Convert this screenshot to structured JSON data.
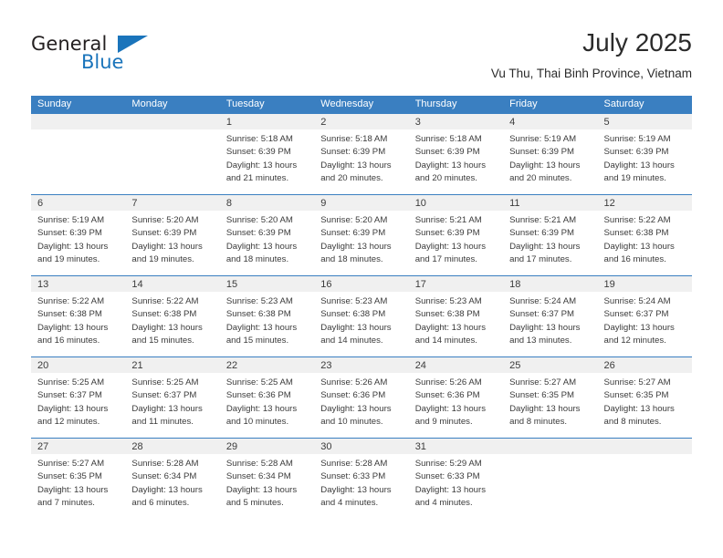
{
  "brand": {
    "name_part1": "General",
    "name_part2": "Blue",
    "triangle_color": "#1a74bb"
  },
  "header": {
    "title": "July 2025",
    "subtitle": "Vu Thu, Thai Binh Province, Vietnam"
  },
  "theme": {
    "header_blue": "#3a7fc1",
    "daynum_gray": "#f0f0f0",
    "text": "#3b3b3b"
  },
  "calendar": {
    "weekdays": [
      "Sunday",
      "Monday",
      "Tuesday",
      "Wednesday",
      "Thursday",
      "Friday",
      "Saturday"
    ],
    "weeks": [
      [
        {
          "day": "",
          "sunrise": "",
          "sunset": "",
          "daylight": ""
        },
        {
          "day": "",
          "sunrise": "",
          "sunset": "",
          "daylight": ""
        },
        {
          "day": "1",
          "sunrise": "Sunrise: 5:18 AM",
          "sunset": "Sunset: 6:39 PM",
          "daylight": "Daylight: 13 hours and 21 minutes."
        },
        {
          "day": "2",
          "sunrise": "Sunrise: 5:18 AM",
          "sunset": "Sunset: 6:39 PM",
          "daylight": "Daylight: 13 hours and 20 minutes."
        },
        {
          "day": "3",
          "sunrise": "Sunrise: 5:18 AM",
          "sunset": "Sunset: 6:39 PM",
          "daylight": "Daylight: 13 hours and 20 minutes."
        },
        {
          "day": "4",
          "sunrise": "Sunrise: 5:19 AM",
          "sunset": "Sunset: 6:39 PM",
          "daylight": "Daylight: 13 hours and 20 minutes."
        },
        {
          "day": "5",
          "sunrise": "Sunrise: 5:19 AM",
          "sunset": "Sunset: 6:39 PM",
          "daylight": "Daylight: 13 hours and 19 minutes."
        }
      ],
      [
        {
          "day": "6",
          "sunrise": "Sunrise: 5:19 AM",
          "sunset": "Sunset: 6:39 PM",
          "daylight": "Daylight: 13 hours and 19 minutes."
        },
        {
          "day": "7",
          "sunrise": "Sunrise: 5:20 AM",
          "sunset": "Sunset: 6:39 PM",
          "daylight": "Daylight: 13 hours and 19 minutes."
        },
        {
          "day": "8",
          "sunrise": "Sunrise: 5:20 AM",
          "sunset": "Sunset: 6:39 PM",
          "daylight": "Daylight: 13 hours and 18 minutes."
        },
        {
          "day": "9",
          "sunrise": "Sunrise: 5:20 AM",
          "sunset": "Sunset: 6:39 PM",
          "daylight": "Daylight: 13 hours and 18 minutes."
        },
        {
          "day": "10",
          "sunrise": "Sunrise: 5:21 AM",
          "sunset": "Sunset: 6:39 PM",
          "daylight": "Daylight: 13 hours and 17 minutes."
        },
        {
          "day": "11",
          "sunrise": "Sunrise: 5:21 AM",
          "sunset": "Sunset: 6:39 PM",
          "daylight": "Daylight: 13 hours and 17 minutes."
        },
        {
          "day": "12",
          "sunrise": "Sunrise: 5:22 AM",
          "sunset": "Sunset: 6:38 PM",
          "daylight": "Daylight: 13 hours and 16 minutes."
        }
      ],
      [
        {
          "day": "13",
          "sunrise": "Sunrise: 5:22 AM",
          "sunset": "Sunset: 6:38 PM",
          "daylight": "Daylight: 13 hours and 16 minutes."
        },
        {
          "day": "14",
          "sunrise": "Sunrise: 5:22 AM",
          "sunset": "Sunset: 6:38 PM",
          "daylight": "Daylight: 13 hours and 15 minutes."
        },
        {
          "day": "15",
          "sunrise": "Sunrise: 5:23 AM",
          "sunset": "Sunset: 6:38 PM",
          "daylight": "Daylight: 13 hours and 15 minutes."
        },
        {
          "day": "16",
          "sunrise": "Sunrise: 5:23 AM",
          "sunset": "Sunset: 6:38 PM",
          "daylight": "Daylight: 13 hours and 14 minutes."
        },
        {
          "day": "17",
          "sunrise": "Sunrise: 5:23 AM",
          "sunset": "Sunset: 6:38 PM",
          "daylight": "Daylight: 13 hours and 14 minutes."
        },
        {
          "day": "18",
          "sunrise": "Sunrise: 5:24 AM",
          "sunset": "Sunset: 6:37 PM",
          "daylight": "Daylight: 13 hours and 13 minutes."
        },
        {
          "day": "19",
          "sunrise": "Sunrise: 5:24 AM",
          "sunset": "Sunset: 6:37 PM",
          "daylight": "Daylight: 13 hours and 12 minutes."
        }
      ],
      [
        {
          "day": "20",
          "sunrise": "Sunrise: 5:25 AM",
          "sunset": "Sunset: 6:37 PM",
          "daylight": "Daylight: 13 hours and 12 minutes."
        },
        {
          "day": "21",
          "sunrise": "Sunrise: 5:25 AM",
          "sunset": "Sunset: 6:37 PM",
          "daylight": "Daylight: 13 hours and 11 minutes."
        },
        {
          "day": "22",
          "sunrise": "Sunrise: 5:25 AM",
          "sunset": "Sunset: 6:36 PM",
          "daylight": "Daylight: 13 hours and 10 minutes."
        },
        {
          "day": "23",
          "sunrise": "Sunrise: 5:26 AM",
          "sunset": "Sunset: 6:36 PM",
          "daylight": "Daylight: 13 hours and 10 minutes."
        },
        {
          "day": "24",
          "sunrise": "Sunrise: 5:26 AM",
          "sunset": "Sunset: 6:36 PM",
          "daylight": "Daylight: 13 hours and 9 minutes."
        },
        {
          "day": "25",
          "sunrise": "Sunrise: 5:27 AM",
          "sunset": "Sunset: 6:35 PM",
          "daylight": "Daylight: 13 hours and 8 minutes."
        },
        {
          "day": "26",
          "sunrise": "Sunrise: 5:27 AM",
          "sunset": "Sunset: 6:35 PM",
          "daylight": "Daylight: 13 hours and 8 minutes."
        }
      ],
      [
        {
          "day": "27",
          "sunrise": "Sunrise: 5:27 AM",
          "sunset": "Sunset: 6:35 PM",
          "daylight": "Daylight: 13 hours and 7 minutes."
        },
        {
          "day": "28",
          "sunrise": "Sunrise: 5:28 AM",
          "sunset": "Sunset: 6:34 PM",
          "daylight": "Daylight: 13 hours and 6 minutes."
        },
        {
          "day": "29",
          "sunrise": "Sunrise: 5:28 AM",
          "sunset": "Sunset: 6:34 PM",
          "daylight": "Daylight: 13 hours and 5 minutes."
        },
        {
          "day": "30",
          "sunrise": "Sunrise: 5:28 AM",
          "sunset": "Sunset: 6:33 PM",
          "daylight": "Daylight: 13 hours and 4 minutes."
        },
        {
          "day": "31",
          "sunrise": "Sunrise: 5:29 AM",
          "sunset": "Sunset: 6:33 PM",
          "daylight": "Daylight: 13 hours and 4 minutes."
        },
        {
          "day": "",
          "sunrise": "",
          "sunset": "",
          "daylight": ""
        },
        {
          "day": "",
          "sunrise": "",
          "sunset": "",
          "daylight": ""
        }
      ]
    ]
  }
}
